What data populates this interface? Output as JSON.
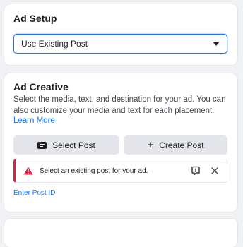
{
  "ad_setup": {
    "title": "Ad Setup",
    "select_value": "Use Existing Post",
    "select_icon": "caret-down-icon"
  },
  "ad_creative": {
    "title": "Ad Creative",
    "description": "Select the media, text, and destination for your ad. You can also customize your media and text for each placement.",
    "learn_more": "Learn More",
    "select_post_label": "Select Post",
    "select_post_icon": "post-icon",
    "create_post_label": "Create Post",
    "create_post_icon": "plus-icon",
    "alert": {
      "message": "Select an existing post for your ad.",
      "icon": "warning-icon",
      "color": "#e41e3f"
    },
    "enter_post_id": "Enter Post ID"
  },
  "colors": {
    "accent": "#1877f2",
    "error": "#e41e3f",
    "background": "#f0f2f5"
  }
}
